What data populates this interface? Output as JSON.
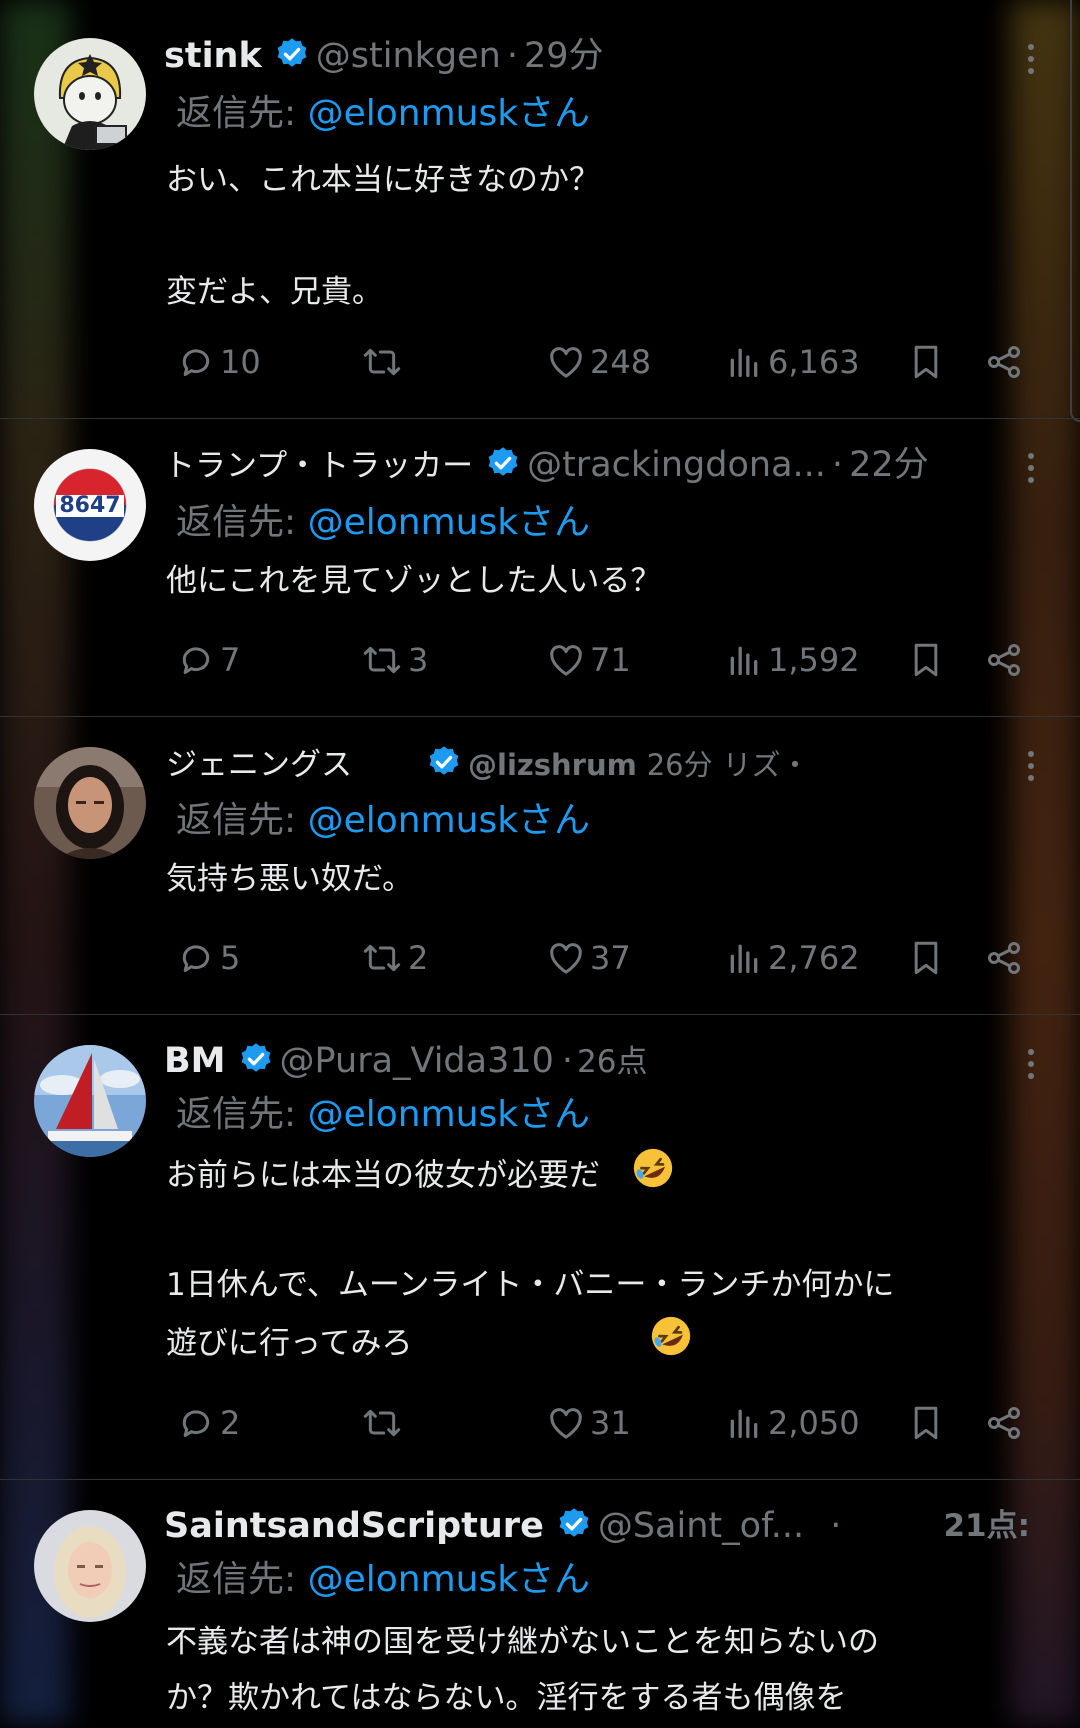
{
  "tweets": [
    {
      "name": "stink",
      "handle": "@stinkgen",
      "sep": "·",
      "time": "29分",
      "reply_prefix": "返信先: ",
      "reply_to": "@elonmuskさん",
      "body": [
        "おい、これ本当に好きなのか？",
        "変だよ、兄貴。"
      ],
      "replies": "10",
      "retweets": "",
      "likes": "248",
      "views": "6,163"
    },
    {
      "name": "トランプ・トラッカー",
      "handle": "@trackingdona...",
      "sep": "·",
      "time": "22分",
      "avatar_text": "8647",
      "reply_prefix": "返信先: ",
      "reply_to": "@elonmuskさん",
      "body": [
        "他にこれを見てゾッとした人いる？"
      ],
      "replies": "7",
      "retweets": "3",
      "likes": "71",
      "views": "1,592"
    },
    {
      "name": "ジェニングス",
      "handle": "@lizshrum",
      "time": "26分",
      "extra": "リズ・",
      "reply_prefix": "返信先: ",
      "reply_to": "@elonmuskさん",
      "body": [
        "気持ち悪い奴だ。"
      ],
      "replies": "5",
      "retweets": "2",
      "likes": "37",
      "views": "2,762"
    },
    {
      "name": "BM",
      "handle": "@Pura_Vida310",
      "sep": "·",
      "time": "26点",
      "reply_prefix": "返信先: ",
      "reply_to": "@elonmuskさん",
      "body": [
        "お前らには本当の彼女が必要だ",
        "1日休んで、ムーンライト・バニー・ランチか何かに",
        "遊びに行ってみろ"
      ],
      "replies": "2",
      "retweets": "",
      "likes": "31",
      "views": "2,050"
    },
    {
      "name": "SaintsandScripture",
      "handle": "@Saint_of...",
      "sep": "·",
      "time": "21点:",
      "reply_prefix": "返信先: ",
      "reply_to": "@elonmuskさん",
      "body": [
        "不義な者は神の国を受け継がないことを知らないの",
        "か？欺かれてはならない。淫行をする者も偶像を"
      ]
    }
  ],
  "icons": {
    "verified": "verified-badge-icon",
    "reply": "reply-icon",
    "retweet": "retweet-icon",
    "like": "heart-icon",
    "views": "views-icon",
    "bookmark": "bookmark-icon",
    "share": "share-icon",
    "more": "more-icon"
  },
  "colors": {
    "background": "#000000",
    "text": "#e7e9ea",
    "muted": "#71767b",
    "link": "#1d9bf0",
    "emoji": "#f7c237"
  }
}
